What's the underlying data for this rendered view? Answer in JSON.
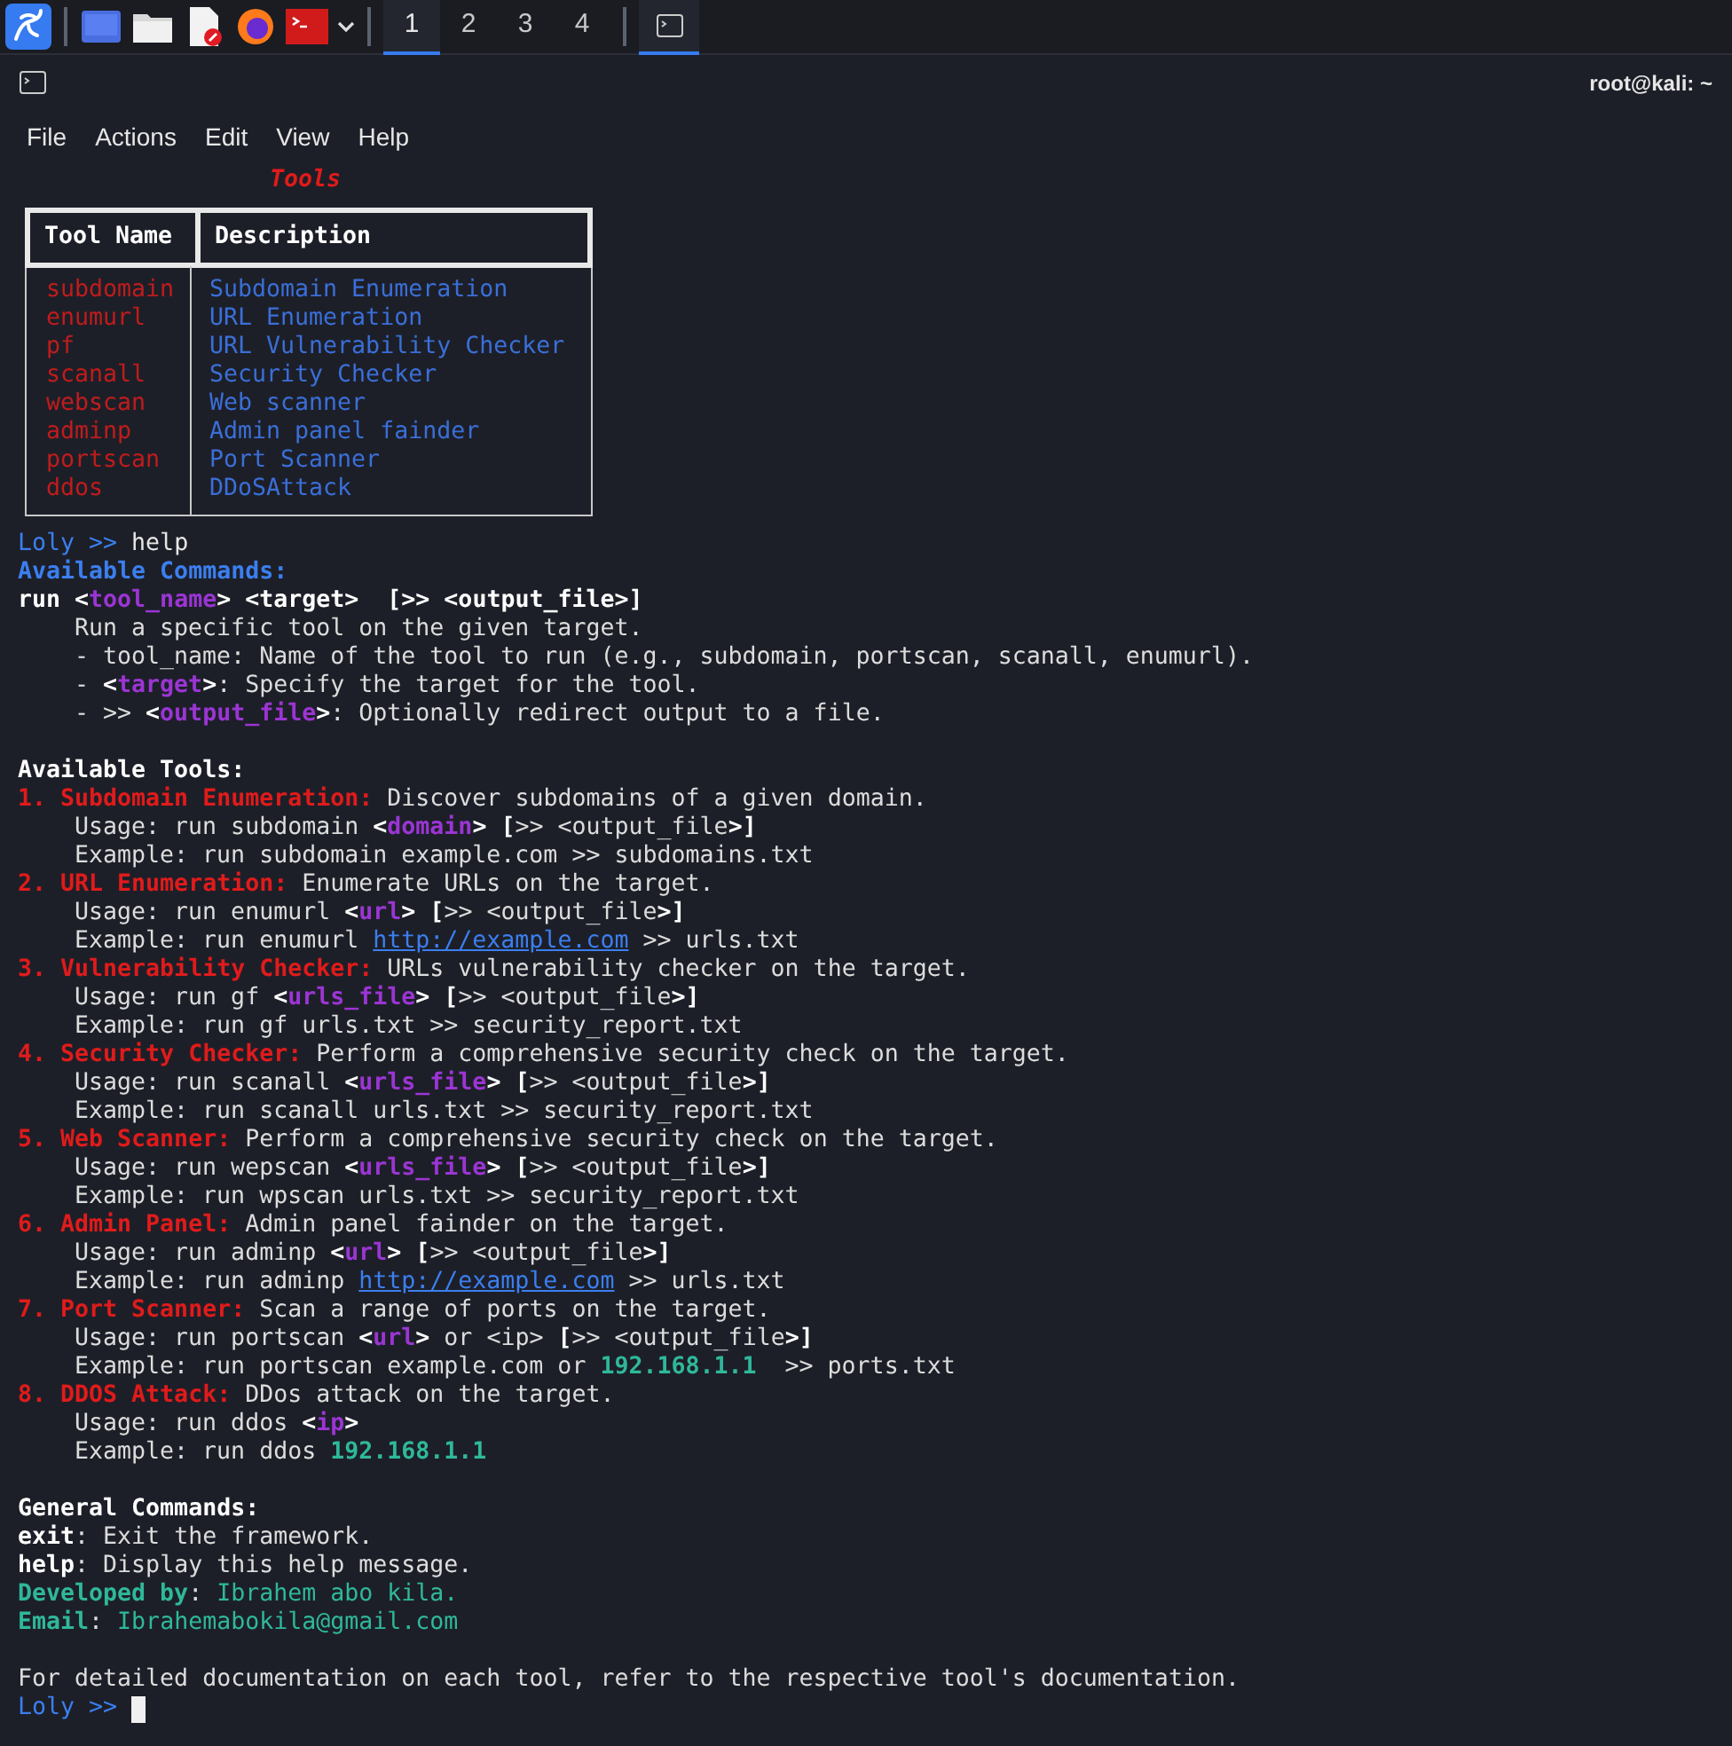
{
  "taskbar": {
    "workspaces": [
      {
        "label": "1",
        "selected": true
      },
      {
        "label": "2",
        "selected": false
      },
      {
        "label": "3",
        "selected": false
      },
      {
        "label": "4",
        "selected": false
      }
    ],
    "terminal_window_selected": true
  },
  "window": {
    "title": "root@kali: ~",
    "menu": [
      "File",
      "Actions",
      "Edit",
      "View",
      "Help"
    ]
  },
  "tools_table": {
    "title": "Tools",
    "columns": [
      "Tool Name",
      "Description"
    ],
    "rows": [
      {
        "name": "subdomain",
        "description": "Subdomain Enumeration"
      },
      {
        "name": "enumurl",
        "description": "URL Enumeration"
      },
      {
        "name": "pf",
        "description": "URL Vulnerability Checker"
      },
      {
        "name": "scanall",
        "description": "Security Checker"
      },
      {
        "name": "webscan",
        "description": "Web scanner"
      },
      {
        "name": "adminp",
        "description": "Admin panel fainder"
      },
      {
        "name": "portscan",
        "description": "Port Scanner"
      },
      {
        "name": "ddos",
        "description": "DDoSAttack"
      }
    ]
  },
  "lines": [
    {
      "kind": "prompt",
      "prompt": "Loly >>",
      "command": "help"
    },
    {
      "kind": "text",
      "segments": [
        {
          "text": "Available Commands:",
          "kind": "heading"
        }
      ]
    },
    {
      "kind": "text",
      "segments": [
        {
          "text": "run <",
          "kind": "bold"
        },
        {
          "text": "tool_name",
          "kind": "param"
        },
        {
          "text": "> <target>  [>> <output_file>]",
          "kind": "bold"
        }
      ]
    },
    {
      "kind": "indented",
      "segments": [
        {
          "text": "Run a specific tool on the given target.",
          "kind": "plain"
        }
      ]
    },
    {
      "kind": "indented",
      "segments": [
        {
          "text": "- tool_name: Name of the tool to run (e.g., subdomain, portscan, scanall, enumurl).",
          "kind": "plain"
        }
      ]
    },
    {
      "kind": "indented",
      "segments": [
        {
          "text": "- ",
          "kind": "plain"
        },
        {
          "text": "<",
          "kind": "bold"
        },
        {
          "text": "target",
          "kind": "param"
        },
        {
          "text": ">",
          "kind": "bold"
        },
        {
          "text": ": Specify the target for the tool.",
          "kind": "plain"
        }
      ]
    },
    {
      "kind": "indented",
      "segments": [
        {
          "text": "- >> ",
          "kind": "plain"
        },
        {
          "text": "<",
          "kind": "bold"
        },
        {
          "text": "output_file",
          "kind": "param"
        },
        {
          "text": ">",
          "kind": "bold"
        },
        {
          "text": ": Optionally redirect output to a file.",
          "kind": "plain"
        }
      ]
    },
    {
      "kind": "blank"
    },
    {
      "kind": "text",
      "segments": [
        {
          "text": "Available Tools:",
          "kind": "bold"
        }
      ]
    },
    {
      "kind": "text",
      "segments": [
        {
          "text": "1. Subdomain Enumeration:",
          "kind": "tool"
        },
        {
          "text": " Discover subdomains of a given domain.",
          "kind": "plain"
        }
      ]
    },
    {
      "kind": "indented",
      "segments": [
        {
          "text": "Usage: run subdomain ",
          "kind": "plain"
        },
        {
          "text": "<",
          "kind": "bold"
        },
        {
          "text": "domain",
          "kind": "param"
        },
        {
          "text": ">",
          "kind": "bold"
        },
        {
          "text": " [",
          "kind": "bold"
        },
        {
          "text": ">> <output_file",
          "kind": "plain"
        },
        {
          "text": ">]",
          "kind": "bold"
        }
      ]
    },
    {
      "kind": "indented",
      "segments": [
        {
          "text": "Example: run subdomain example.com >> subdomains.txt",
          "kind": "plain"
        }
      ]
    },
    {
      "kind": "text",
      "segments": [
        {
          "text": "2. URL Enumeration:",
          "kind": "tool"
        },
        {
          "text": " Enumerate URLs on the target.",
          "kind": "plain"
        }
      ]
    },
    {
      "kind": "indented",
      "segments": [
        {
          "text": "Usage: run enumurl ",
          "kind": "plain"
        },
        {
          "text": "<",
          "kind": "bold"
        },
        {
          "text": "url",
          "kind": "param"
        },
        {
          "text": ">",
          "kind": "bold"
        },
        {
          "text": " [",
          "kind": "bold"
        },
        {
          "text": ">> <output_file",
          "kind": "plain"
        },
        {
          "text": ">]",
          "kind": "bold"
        }
      ]
    },
    {
      "kind": "indented",
      "segments": [
        {
          "text": "Example: run enumurl ",
          "kind": "plain"
        },
        {
          "text": "http://example.com",
          "kind": "link"
        },
        {
          "text": " >> urls.txt",
          "kind": "plain"
        }
      ]
    },
    {
      "kind": "text",
      "segments": [
        {
          "text": "3. Vulnerability Checker:",
          "kind": "tool"
        },
        {
          "text": " URLs vulnerability checker on the target.",
          "kind": "plain"
        }
      ]
    },
    {
      "kind": "indented",
      "segments": [
        {
          "text": "Usage: run gf ",
          "kind": "plain"
        },
        {
          "text": "<",
          "kind": "bold"
        },
        {
          "text": "urls_file",
          "kind": "param"
        },
        {
          "text": ">",
          "kind": "bold"
        },
        {
          "text": " [",
          "kind": "bold"
        },
        {
          "text": ">> <output_file",
          "kind": "plain"
        },
        {
          "text": ">]",
          "kind": "bold"
        }
      ]
    },
    {
      "kind": "indented",
      "segments": [
        {
          "text": "Example: run gf urls.txt >> security_report.txt",
          "kind": "plain"
        }
      ]
    },
    {
      "kind": "text",
      "segments": [
        {
          "text": "4. Security Checker:",
          "kind": "tool"
        },
        {
          "text": " Perform a comprehensive security check on the target.",
          "kind": "plain"
        }
      ]
    },
    {
      "kind": "indented",
      "segments": [
        {
          "text": "Usage: run scanall ",
          "kind": "plain"
        },
        {
          "text": "<",
          "kind": "bold"
        },
        {
          "text": "urls_file",
          "kind": "param"
        },
        {
          "text": ">",
          "kind": "bold"
        },
        {
          "text": " [",
          "kind": "bold"
        },
        {
          "text": ">> <output_file",
          "kind": "plain"
        },
        {
          "text": ">]",
          "kind": "bold"
        }
      ]
    },
    {
      "kind": "indented",
      "segments": [
        {
          "text": "Example: run scanall urls.txt >> security_report.txt",
          "kind": "plain"
        }
      ]
    },
    {
      "kind": "text",
      "segments": [
        {
          "text": "5. Web Scanner:",
          "kind": "tool"
        },
        {
          "text": " Perform a comprehensive security check on the target.",
          "kind": "plain"
        }
      ]
    },
    {
      "kind": "indented",
      "segments": [
        {
          "text": "Usage: run wepscan ",
          "kind": "plain"
        },
        {
          "text": "<",
          "kind": "bold"
        },
        {
          "text": "urls_file",
          "kind": "param"
        },
        {
          "text": ">",
          "kind": "bold"
        },
        {
          "text": " [",
          "kind": "bold"
        },
        {
          "text": ">> <output_file",
          "kind": "plain"
        },
        {
          "text": ">]",
          "kind": "bold"
        }
      ]
    },
    {
      "kind": "indented",
      "segments": [
        {
          "text": "Example: run wpscan urls.txt >> security_report.txt",
          "kind": "plain"
        }
      ]
    },
    {
      "kind": "text",
      "segments": [
        {
          "text": "6. Admin Panel:",
          "kind": "tool"
        },
        {
          "text": " Admin panel fainder on the target.",
          "kind": "plain"
        }
      ]
    },
    {
      "kind": "indented",
      "segments": [
        {
          "text": "Usage: run adminp ",
          "kind": "plain"
        },
        {
          "text": "<",
          "kind": "bold"
        },
        {
          "text": "url",
          "kind": "param"
        },
        {
          "text": ">",
          "kind": "bold"
        },
        {
          "text": " [",
          "kind": "bold"
        },
        {
          "text": ">> <output_file",
          "kind": "plain"
        },
        {
          "text": ">]",
          "kind": "bold"
        }
      ]
    },
    {
      "kind": "indented",
      "segments": [
        {
          "text": "Example: run adminp ",
          "kind": "plain"
        },
        {
          "text": "http://example.com",
          "kind": "link"
        },
        {
          "text": " >> urls.txt",
          "kind": "plain"
        }
      ]
    },
    {
      "kind": "text",
      "segments": [
        {
          "text": "7. Port Scanner:",
          "kind": "tool"
        },
        {
          "text": " Scan a range of ports on the target.",
          "kind": "plain"
        }
      ]
    },
    {
      "kind": "indented",
      "segments": [
        {
          "text": "Usage: run portscan ",
          "kind": "plain"
        },
        {
          "text": "<",
          "kind": "bold"
        },
        {
          "text": "url",
          "kind": "param"
        },
        {
          "text": ">",
          "kind": "bold"
        },
        {
          "text": " or <ip> ",
          "kind": "plain"
        },
        {
          "text": "[",
          "kind": "bold"
        },
        {
          "text": ">> <output_file",
          "kind": "plain"
        },
        {
          "text": ">]",
          "kind": "bold"
        }
      ]
    },
    {
      "kind": "indented",
      "segments": [
        {
          "text": "Example: run portscan example.com or ",
          "kind": "plain"
        },
        {
          "text": "192.168.1.1",
          "kind": "accent"
        },
        {
          "text": "  >> ports.txt",
          "kind": "plain"
        }
      ]
    },
    {
      "kind": "text",
      "segments": [
        {
          "text": "8. DDOS Attack:",
          "kind": "tool"
        },
        {
          "text": " DDos attack on the target.",
          "kind": "plain"
        }
      ]
    },
    {
      "kind": "indented",
      "segments": [
        {
          "text": "Usage: run ddos ",
          "kind": "plain"
        },
        {
          "text": "<",
          "kind": "bold"
        },
        {
          "text": "ip",
          "kind": "param"
        },
        {
          "text": ">",
          "kind": "bold"
        }
      ]
    },
    {
      "kind": "indented",
      "segments": [
        {
          "text": "Example: run ddos ",
          "kind": "plain"
        },
        {
          "text": "192.168.1.1",
          "kind": "accent"
        }
      ]
    },
    {
      "kind": "blank"
    },
    {
      "kind": "text",
      "segments": [
        {
          "text": "General Commands:",
          "kind": "bold"
        }
      ]
    },
    {
      "kind": "text",
      "segments": [
        {
          "text": "exit",
          "kind": "bold"
        },
        {
          "text": ": Exit the framework.",
          "kind": "plain"
        }
      ]
    },
    {
      "kind": "text",
      "segments": [
        {
          "text": "help",
          "kind": "bold"
        },
        {
          "text": ": Display this help message.",
          "kind": "plain"
        }
      ]
    },
    {
      "kind": "text",
      "segments": [
        {
          "text": "Developed by",
          "kind": "accent"
        },
        {
          "text": ": ",
          "kind": "plain"
        },
        {
          "text": "Ibrahem abo kila.",
          "kind": "accent-light"
        }
      ]
    },
    {
      "kind": "text",
      "segments": [
        {
          "text": "Email",
          "kind": "accent"
        },
        {
          "text": ": ",
          "kind": "plain"
        },
        {
          "text": "Ibrahemabokila@gmail.com",
          "kind": "accent-light"
        }
      ]
    },
    {
      "kind": "blank"
    },
    {
      "kind": "text",
      "segments": [
        {
          "text": "For detailed documentation on each tool, refer to the respective tool's documentation.",
          "kind": "plain"
        }
      ]
    },
    {
      "kind": "prompt",
      "prompt": "Loly >>",
      "cursor": true
    }
  ]
}
